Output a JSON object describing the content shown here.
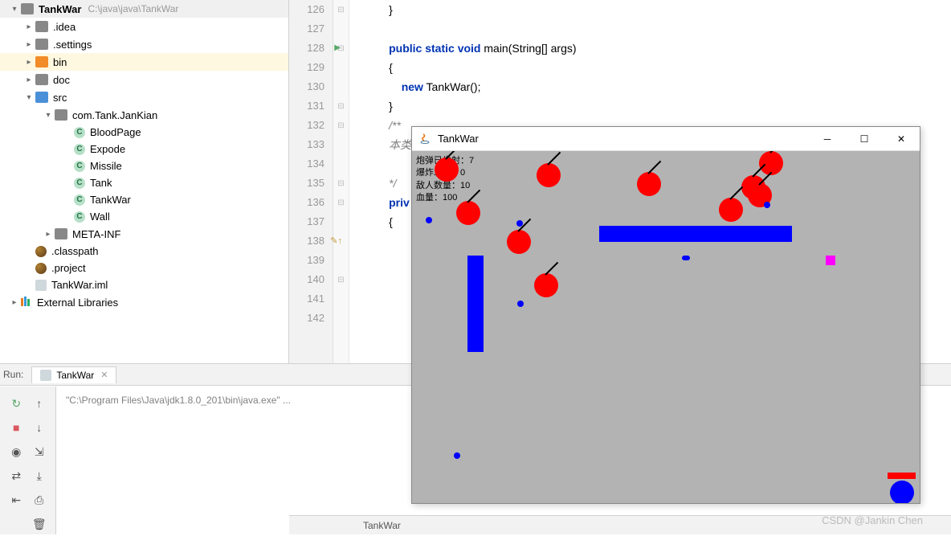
{
  "project": {
    "name": "TankWar",
    "path": "C:\\java\\java\\TankWar",
    "tree": [
      {
        "label": ".idea",
        "type": "folder-gray",
        "indent": 1
      },
      {
        "label": ".settings",
        "type": "folder-gray",
        "indent": 1
      },
      {
        "label": "bin",
        "type": "folder-orange",
        "indent": 1,
        "selected": true
      },
      {
        "label": "doc",
        "type": "folder-gray",
        "indent": 1
      },
      {
        "label": "src",
        "type": "folder-blue",
        "indent": 1,
        "expanded": true
      },
      {
        "label": "com.Tank.JanKian",
        "type": "folder-gray",
        "indent": 2,
        "expanded": true
      },
      {
        "label": "BloodPage",
        "type": "class",
        "indent": 3
      },
      {
        "label": "Expode",
        "type": "class",
        "indent": 3
      },
      {
        "label": "Missile",
        "type": "class",
        "indent": 3
      },
      {
        "label": "Tank",
        "type": "class",
        "indent": 3
      },
      {
        "label": "TankWar",
        "type": "class",
        "indent": 3
      },
      {
        "label": "Wall",
        "type": "class",
        "indent": 3
      },
      {
        "label": "META-INF",
        "type": "folder-gray",
        "indent": 2
      },
      {
        "label": ".classpath",
        "type": "eclipse",
        "indent": 1
      },
      {
        "label": ".project",
        "type": "eclipse",
        "indent": 1
      },
      {
        "label": "TankWar.iml",
        "type": "module",
        "indent": 1
      }
    ],
    "external_libs": "External Libraries"
  },
  "editor": {
    "line_start": 126,
    "line_end": 142,
    "tab": "TankWar",
    "lines": {
      "126": "        }",
      "128a": "public static void",
      "128b": " main(String[] args)",
      "129": "{",
      "130a": "new",
      "130b": " TankWar();",
      "131": "}",
      "132": "/** ",
      "133": "本类",
      "135": "*/",
      "136": "priv",
      "137": "{"
    }
  },
  "run": {
    "title": "Run:",
    "tab": "TankWar",
    "console": "\"C:\\Program Files\\Java\\jdk1.8.0_201\\bin\\java.exe\" ..."
  },
  "game": {
    "title": "TankWar",
    "stats": {
      "line1": "炮弹已发射：7",
      "line2": "爆炸发生：0",
      "line3": "敌人数量：10",
      "line4": "血量：100"
    }
  },
  "watermark": "CSDN @Jankin     Chen"
}
